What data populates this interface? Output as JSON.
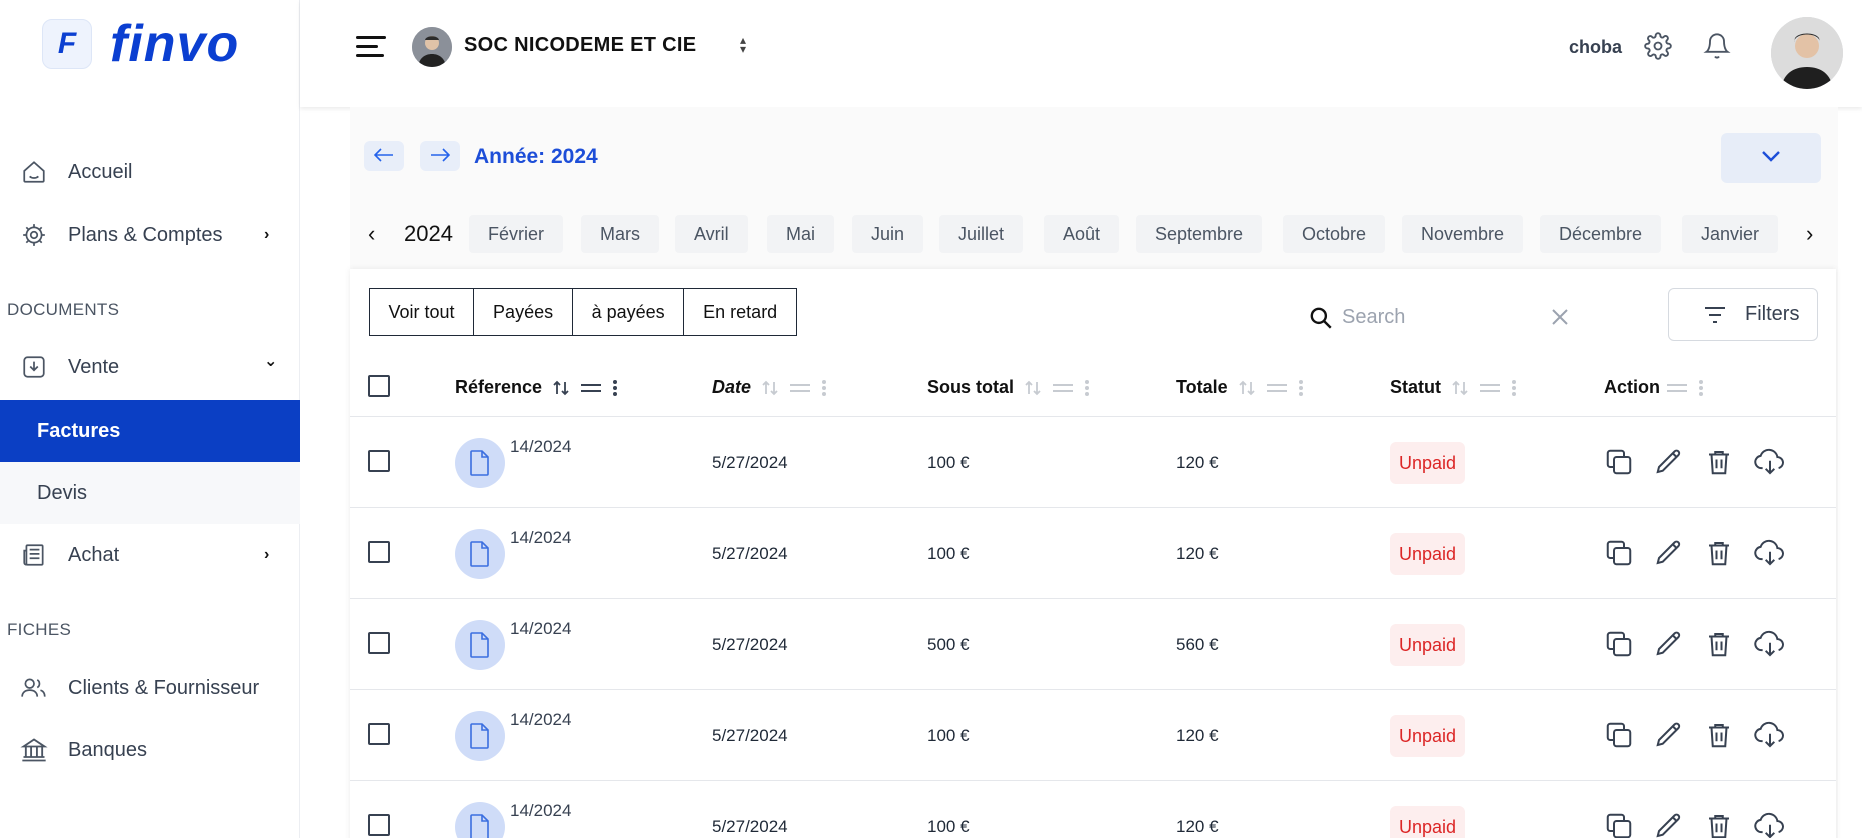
{
  "brand": {
    "logo_mark": "F",
    "name": "finvo",
    "color": "#0b3fd1"
  },
  "sidebar": {
    "items": [
      {
        "label": "Accueil",
        "icon": "home-icon"
      },
      {
        "label": "Plans & Comptes",
        "icon": "gear-icon",
        "chevron": "›"
      }
    ],
    "sections": [
      {
        "label": "DOCUMENTS"
      },
      {
        "label": "FICHES"
      }
    ],
    "vente": {
      "label": "Vente",
      "icon": "download-doc-icon",
      "chevron": "⌄"
    },
    "vente_children": [
      {
        "label": "Factures",
        "active": true
      },
      {
        "label": "Devis"
      }
    ],
    "achat": {
      "label": "Achat",
      "icon": "newspaper-icon",
      "chevron": "›"
    },
    "fiches_items": [
      {
        "label": "Clients & Fournisseur",
        "icon": "users-icon"
      },
      {
        "label": "Banques",
        "icon": "bank-icon"
      }
    ]
  },
  "header": {
    "company": "SOC NICODEME ET CIE",
    "username": "choba"
  },
  "period": {
    "year_label": "Année: 2024",
    "year": "2024",
    "months": [
      "Février",
      "Mars",
      "Avril",
      "Mai",
      "Juin",
      "Juillet",
      "Août",
      "Septembre",
      "Octobre",
      "Novembre",
      "Décembre",
      "Janvier"
    ]
  },
  "filters": {
    "tabs": [
      "Voir tout",
      "Payées",
      "à payées",
      "En retard"
    ],
    "search_placeholder": "Search",
    "filters_label": "Filters"
  },
  "table": {
    "columns": {
      "reference": "Réference",
      "date": "Date",
      "sous_total": "Sous total",
      "totale": "Totale",
      "statut": "Statut",
      "action": "Action"
    },
    "rows": [
      {
        "reference": "14/2024",
        "date": "5/27/2024",
        "sous_total": "100 €",
        "totale": "120 €",
        "statut": "Unpaid"
      },
      {
        "reference": "14/2024",
        "date": "5/27/2024",
        "sous_total": "100 €",
        "totale": "120 €",
        "statut": "Unpaid"
      },
      {
        "reference": "14/2024",
        "date": "5/27/2024",
        "sous_total": "500 €",
        "totale": "560 €",
        "statut": "Unpaid"
      },
      {
        "reference": "14/2024",
        "date": "5/27/2024",
        "sous_total": "100 €",
        "totale": "120 €",
        "statut": "Unpaid"
      },
      {
        "reference": "14/2024",
        "date": "5/27/2024",
        "sous_total": "100 €",
        "totale": "120 €",
        "statut": "Unpaid"
      }
    ],
    "status_color": "#dc2626",
    "row_actions": [
      "copy-icon",
      "edit-icon",
      "trash-icon",
      "cloud-download-icon"
    ]
  },
  "colors": {
    "primary": "#0b3fc4",
    "accent_blue": "#1d4ed8"
  }
}
